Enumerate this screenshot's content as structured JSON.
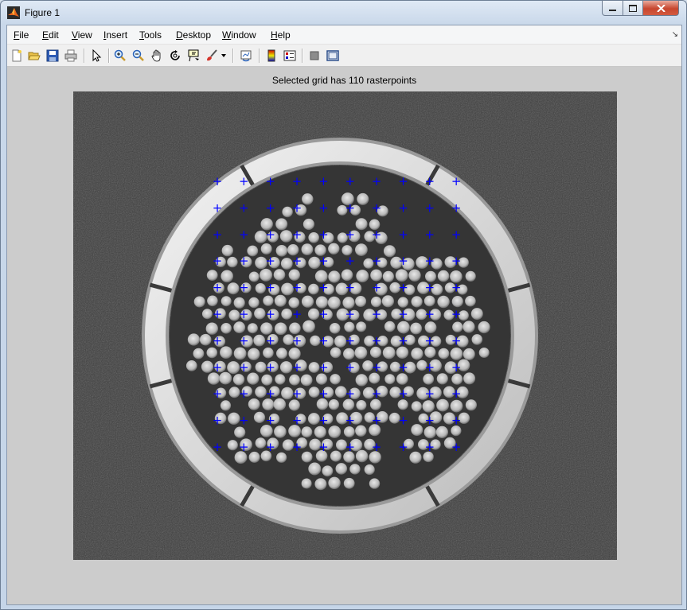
{
  "window": {
    "title": "Figure 1"
  },
  "menu": [
    {
      "pre": "",
      "u": "F",
      "post": "ile"
    },
    {
      "pre": "",
      "u": "E",
      "post": "dit"
    },
    {
      "pre": "",
      "u": "V",
      "post": "iew"
    },
    {
      "pre": "",
      "u": "I",
      "post": "nsert"
    },
    {
      "pre": "",
      "u": "T",
      "post": "ools"
    },
    {
      "pre": "",
      "u": "D",
      "post": "esktop"
    },
    {
      "pre": "",
      "u": "W",
      "post": "indow"
    },
    {
      "pre": "",
      "u": "H",
      "post": "elp"
    }
  ],
  "toolbar_icons": [
    "new-figure-icon",
    "open-file-icon",
    "save-icon",
    "print-icon",
    "edit-plot-arrow-icon",
    "zoom-in-icon",
    "zoom-out-icon",
    "pan-hand-icon",
    "rotate-3d-icon",
    "data-cursor-icon",
    "brush-icon",
    "brush-dropdown-icon",
    "link-plot-icon",
    "colorbar-icon",
    "legend-icon",
    "hide-plot-tools-icon",
    "show-plot-tools-icon"
  ],
  "plot": {
    "title": "Selected grid has 110 rasterpoints",
    "marker": "+",
    "marker_color": "#0000ff",
    "grid_columns": 10,
    "grid_rows": 11,
    "image_description_colors": {
      "background": "#3b3b3b",
      "ring": "#e0e0e0",
      "fibers": "#c9c9c9"
    }
  }
}
